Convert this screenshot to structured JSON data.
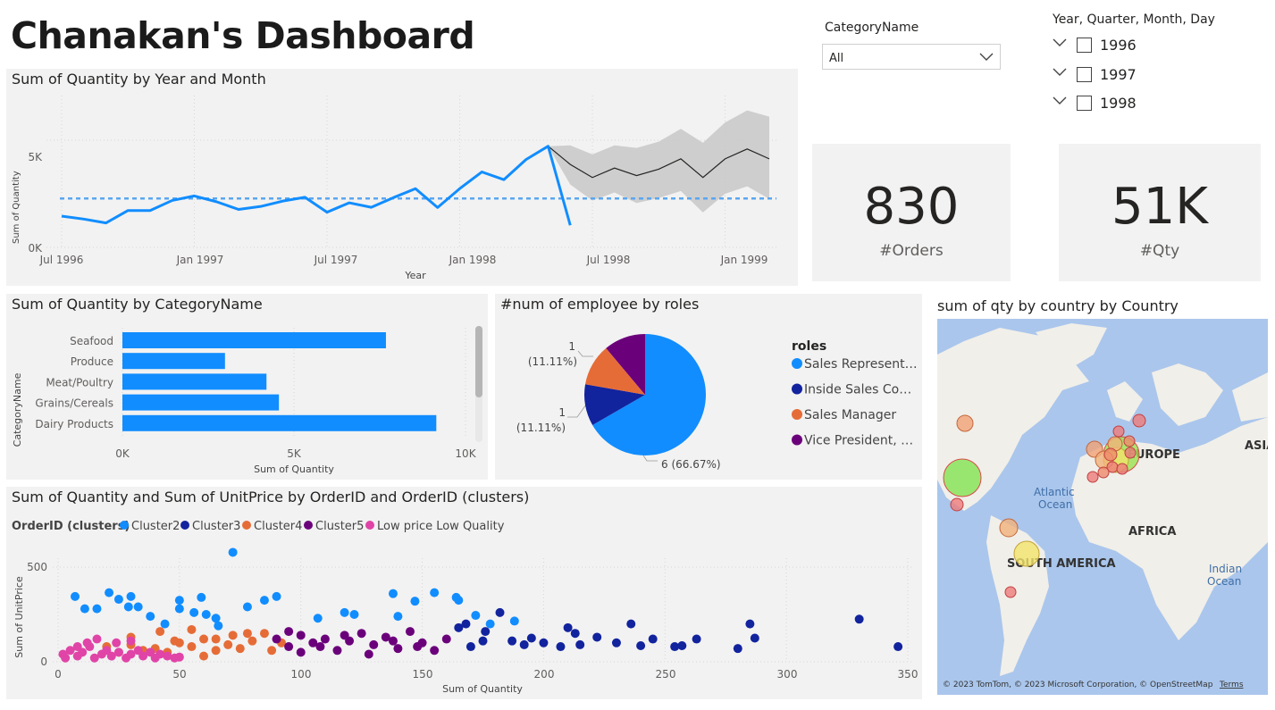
{
  "header": {
    "title": "Chanakan's Dashboard"
  },
  "category_slicer": {
    "title": "CategoryName",
    "selected": "All"
  },
  "date_slicer": {
    "title": "Year, Quarter, Month, Day",
    "years": [
      "1996",
      "1997",
      "1998"
    ]
  },
  "cards": [
    {
      "value": "830",
      "label": "#Orders"
    },
    {
      "value": "51K",
      "label": "#Qty"
    }
  ],
  "line_chart": {
    "title": "Sum of Quantity by Year and Month",
    "ylabel": "Sum of Quantity",
    "xlabel": "Year",
    "y_ticks": [
      "0K",
      "5K"
    ],
    "x_ticks": [
      "Jul 1996",
      "Jan 1997",
      "Jul 1997",
      "Jan 1998",
      "Jul 1998",
      "Jan 1999"
    ]
  },
  "bar_chart": {
    "title": "Sum of Quantity by CategoryName",
    "ylabel": "CategoryName",
    "xlabel": "Sum of Quantity",
    "x_ticks": [
      "0K",
      "5K",
      "10K"
    ]
  },
  "pie_chart": {
    "title": "#num of employee by roles",
    "legend_title": "roles",
    "data_labels": [
      "1",
      "(11.11%)",
      "1",
      "(11.11%)",
      "6 (66.67%)"
    ]
  },
  "scatter_chart": {
    "title": "Sum of Quantity and Sum of UnitPrice by OrderID and OrderID (clusters)",
    "legend_title": "OrderID (clusters)",
    "xlabel": "Sum of Quantity",
    "ylabel": "Sum of UnitPrice",
    "x_ticks": [
      "0",
      "50",
      "100",
      "150",
      "200",
      "250",
      "300",
      "350"
    ],
    "y_ticks": [
      "0",
      "500"
    ]
  },
  "map": {
    "title": "sum of qty by country by Country",
    "labels": {
      "europe": "EUROPE",
      "asia": "ASIA",
      "africa": "AFRICA",
      "south_america": "SOUTH AMERICA",
      "atlantic1": "Atlantic",
      "atlantic2": "Ocean",
      "indian1": "Indian",
      "indian2": "Ocean"
    },
    "attribution": "© 2023 TomTom, © 2023 Microsoft Corporation, © OpenStreetMap",
    "terms": "Terms",
    "colors": {
      "water": "#aac6ec",
      "land": "#f1efe9"
    }
  },
  "chart_data": [
    {
      "type": "line",
      "title": "Sum of Quantity by Year and Month",
      "xlabel": "Year",
      "ylabel": "Sum of Quantity",
      "ylim": [
        0,
        7500
      ],
      "x_range": [
        "1996-07",
        "1999-03"
      ],
      "series": [
        {
          "values": [
            [
              "1996-07",
              1460
            ],
            [
              "1996-08",
              1320
            ],
            [
              "1996-09",
              1140
            ],
            [
              "1996-10",
              1720
            ],
            [
              "1996-11",
              1720
            ],
            [
              "1996-12",
              2190
            ],
            [
              "1997-01",
              2400
            ],
            [
              "1997-02",
              2130
            ],
            [
              "1997-03",
              1770
            ],
            [
              "1997-04",
              1910
            ],
            [
              "1997-05",
              2160
            ],
            [
              "1997-06",
              2340
            ],
            [
              "1997-07",
              1640
            ],
            [
              "1997-08",
              2080
            ],
            [
              "1997-09",
              1870
            ],
            [
              "1997-10",
              2320
            ],
            [
              "1997-11",
              2740
            ],
            [
              "1997-12",
              1860
            ],
            [
              "1998-01",
              2740
            ],
            [
              "1998-02",
              3520
            ],
            [
              "1998-03",
              3160
            ],
            [
              "1998-04",
              4100
            ],
            [
              "1998-05",
              4720
            ],
            [
              "1998-06",
              1030
            ]
          ]
        },
        {
          "name": "forecast",
          "values": [
            [
              "1998-05",
              4720
            ],
            [
              "1998-06",
              3870
            ],
            [
              "1998-07",
              3260
            ],
            [
              "1998-08",
              3700
            ],
            [
              "1998-09",
              3350
            ],
            [
              "1998-10",
              3650
            ],
            [
              "1998-11",
              4130
            ],
            [
              "1998-12",
              3260
            ],
            [
              "1999-01",
              4130
            ],
            [
              "1999-02",
              4590
            ],
            [
              "1999-03",
              4130
            ]
          ]
        }
      ],
      "forecast_band": {
        "upper": [
          4720,
          4760,
          4340,
          4760,
          4640,
          4930,
          5530,
          4880,
          5830,
          6390,
          6100
        ],
        "lower": [
          4720,
          2930,
          2180,
          2560,
          2070,
          2300,
          2630,
          1630,
          2500,
          2850,
          2260
        ]
      },
      "reference_line": 2280
    },
    {
      "type": "bar",
      "title": "Sum of Quantity by CategoryName",
      "xlabel": "Sum of Quantity",
      "ylabel": "CategoryName",
      "xlim": [
        0,
        10000
      ],
      "categories": [
        "Seafood",
        "Produce",
        "Meat/Poultry",
        "Grains/Cereals",
        "Dairy Products"
      ],
      "values": [
        7681,
        2990,
        4199,
        4562,
        9149
      ]
    },
    {
      "type": "pie",
      "title": "#num of employee by roles",
      "legend_title": "roles",
      "labels": [
        "Sales Represent…",
        "Inside Sales Co…",
        "Sales Manager",
        "Vice President, …"
      ],
      "values": [
        6,
        1,
        1,
        1
      ],
      "colors": [
        "#118dff",
        "#12239e",
        "#e66c37",
        "#6b007b"
      ]
    },
    {
      "type": "scatter",
      "title": "Sum of Quantity and Sum of UnitPrice by OrderID and OrderID (clusters)",
      "xlabel": "Sum of Quantity",
      "ylabel": "Sum of UnitPrice",
      "xlim": [
        0,
        350
      ],
      "ylim": [
        0,
        600
      ],
      "series": [
        {
          "name": "Cluster2",
          "color": "#118dff",
          "points": [
            [
              7,
              345
            ],
            [
              11,
              280
            ],
            [
              16,
              280
            ],
            [
              21,
              365
            ],
            [
              25,
              330
            ],
            [
              29,
              290
            ],
            [
              30,
              345
            ],
            [
              33,
              290
            ],
            [
              38,
              240
            ],
            [
              44,
              200
            ],
            [
              50,
              325
            ],
            [
              50,
              280
            ],
            [
              56,
              260
            ],
            [
              59,
              340
            ],
            [
              61,
              250
            ],
            [
              65,
              230
            ],
            [
              66,
              190
            ],
            [
              72,
              578
            ],
            [
              78,
              290
            ],
            [
              85,
              325
            ],
            [
              90,
              345
            ],
            [
              107,
              230
            ],
            [
              118,
              260
            ],
            [
              122,
              250
            ],
            [
              138,
              360
            ],
            [
              140,
              240
            ],
            [
              147,
              320
            ],
            [
              155,
              365
            ],
            [
              164,
              340
            ],
            [
              165,
              325
            ],
            [
              172,
              245
            ],
            [
              178,
              200
            ],
            [
              188,
              215
            ]
          ]
        },
        {
          "name": "Cluster3",
          "color": "#12239e",
          "points": [
            [
              165,
              180
            ],
            [
              168,
              200
            ],
            [
              176,
              160
            ],
            [
              182,
              260
            ],
            [
              175,
              110
            ],
            [
              187,
              110
            ],
            [
              195,
              125
            ],
            [
              200,
              100
            ],
            [
              207,
              80
            ],
            [
              210,
              180
            ],
            [
              213,
              150
            ],
            [
              215,
              90
            ],
            [
              230,
              100
            ],
            [
              236,
              200
            ],
            [
              240,
              85
            ],
            [
              245,
              120
            ],
            [
              254,
              80
            ],
            [
              257,
              85
            ],
            [
              263,
              120
            ],
            [
              280,
              70
            ],
            [
              285,
              200
            ],
            [
              287,
              125
            ],
            [
              330,
              225
            ],
            [
              346,
              80
            ],
            [
              170,
              80
            ],
            [
              192,
              90
            ],
            [
              222,
              130
            ]
          ]
        },
        {
          "name": "Cluster4",
          "color": "#e66c37",
          "points": [
            [
              20,
              80
            ],
            [
              30,
              90
            ],
            [
              40,
              70
            ],
            [
              50,
              100
            ],
            [
              60,
              120
            ],
            [
              70,
              90
            ],
            [
              80,
              110
            ],
            [
              85,
              150
            ],
            [
              25,
              50
            ],
            [
              35,
              60
            ],
            [
              45,
              50
            ],
            [
              55,
              80
            ],
            [
              65,
              60
            ],
            [
              75,
              70
            ],
            [
              88,
              60
            ],
            [
              92,
              100
            ],
            [
              42,
              160
            ],
            [
              55,
              170
            ],
            [
              65,
              120
            ],
            [
              78,
              150
            ],
            [
              30,
              130
            ],
            [
              72,
              140
            ],
            [
              48,
              110
            ],
            [
              60,
              30
            ]
          ]
        },
        {
          "name": "Cluster5",
          "color": "#6b007b",
          "points": [
            [
              90,
              120
            ],
            [
              95,
              80
            ],
            [
              100,
              140
            ],
            [
              105,
              100
            ],
            [
              110,
              120
            ],
            [
              115,
              60
            ],
            [
              120,
              110
            ],
            [
              125,
              150
            ],
            [
              130,
              90
            ],
            [
              135,
              130
            ],
            [
              140,
              70
            ],
            [
              145,
              160
            ],
            [
              150,
              100
            ],
            [
              155,
              60
            ],
            [
              160,
              120
            ],
            [
              100,
              50
            ],
            [
              108,
              80
            ],
            [
              118,
              140
            ],
            [
              128,
              40
            ],
            [
              138,
              110
            ],
            [
              148,
              80
            ],
            [
              95,
              160
            ]
          ]
        },
        {
          "name": "Low price Low Quality",
          "color": "#e044a7",
          "points": [
            [
              2,
              40
            ],
            [
              5,
              60
            ],
            [
              8,
              30
            ],
            [
              10,
              50
            ],
            [
              13,
              80
            ],
            [
              15,
              20
            ],
            [
              18,
              40
            ],
            [
              20,
              60
            ],
            [
              22,
              30
            ],
            [
              25,
              50
            ],
            [
              28,
              20
            ],
            [
              30,
              40
            ],
            [
              33,
              60
            ],
            [
              35,
              30
            ],
            [
              38,
              50
            ],
            [
              40,
              20
            ],
            [
              42,
              40
            ],
            [
              45,
              30
            ],
            [
              48,
              20
            ],
            [
              12,
              100
            ],
            [
              16,
              120
            ],
            [
              24,
              100
            ],
            [
              30,
              110
            ],
            [
              8,
              80
            ],
            [
              3,
              20
            ],
            [
              50,
              25
            ]
          ]
        }
      ]
    }
  ]
}
